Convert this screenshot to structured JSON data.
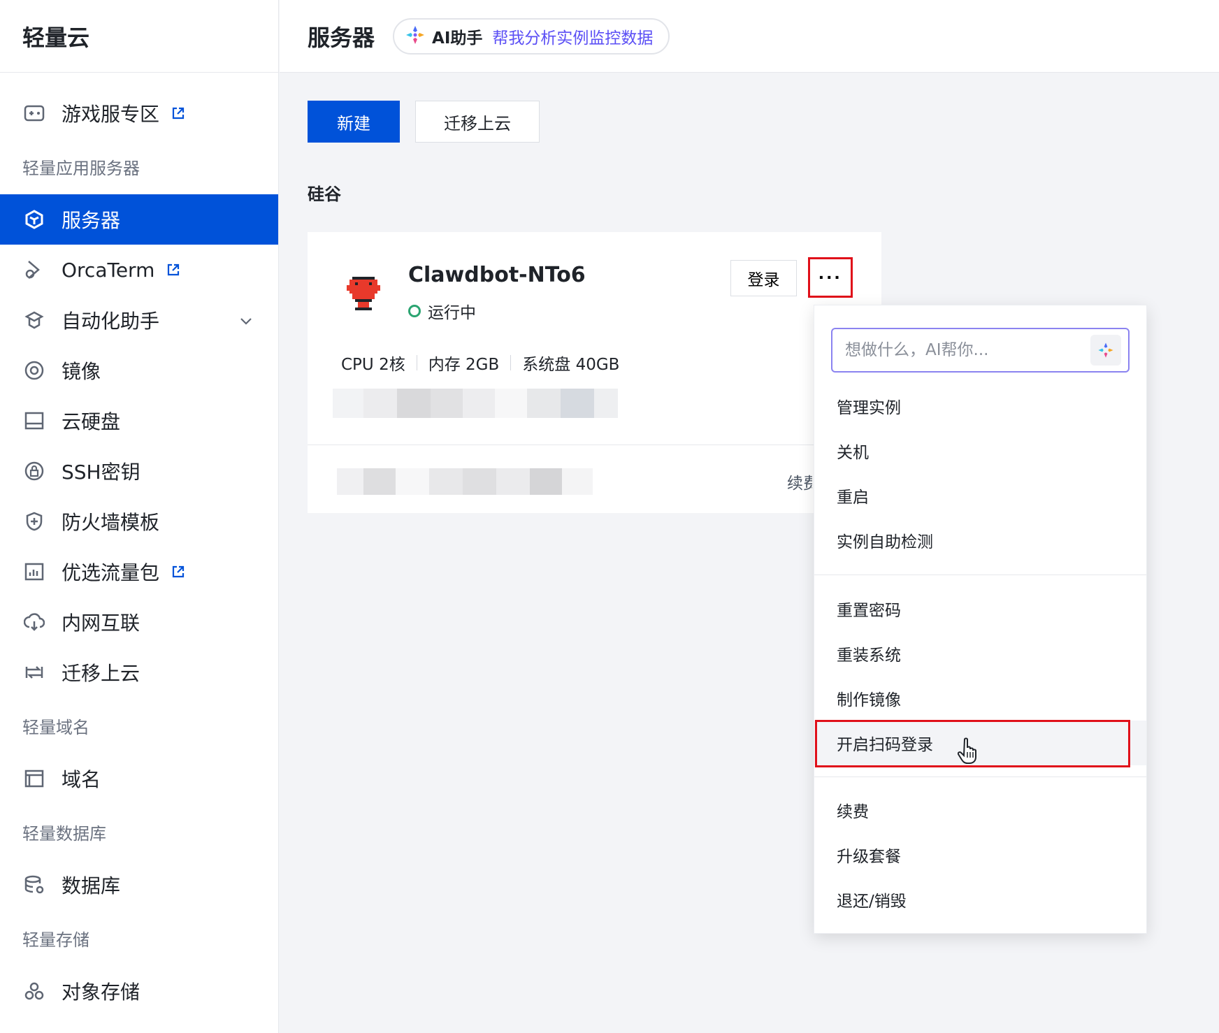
{
  "sidebar": {
    "brand": "轻量云",
    "items": [
      {
        "label": "游戏服专区",
        "icon": "gamepad-icon",
        "external": true
      },
      {
        "group": "轻量应用服务器"
      },
      {
        "label": "服务器",
        "icon": "server-cube-icon",
        "active": true
      },
      {
        "label": "OrcaTerm",
        "icon": "orcaterm-icon",
        "external": true
      },
      {
        "label": "自动化助手",
        "icon": "automation-icon",
        "expandable": true
      },
      {
        "label": "镜像",
        "icon": "image-disc-icon"
      },
      {
        "label": "云硬盘",
        "icon": "cloud-disk-icon"
      },
      {
        "label": "SSH密钥",
        "icon": "ssh-key-icon"
      },
      {
        "label": "防火墙模板",
        "icon": "firewall-shield-icon"
      },
      {
        "label": "优选流量包",
        "icon": "traffic-package-icon",
        "external": true
      },
      {
        "label": "内网互联",
        "icon": "intranet-icon"
      },
      {
        "label": "迁移上云",
        "icon": "migrate-icon"
      },
      {
        "group": "轻量域名"
      },
      {
        "label": "域名",
        "icon": "domain-window-icon"
      },
      {
        "group": "轻量数据库"
      },
      {
        "label": "数据库",
        "icon": "database-icon"
      },
      {
        "group": "轻量存储"
      },
      {
        "label": "对象存储",
        "icon": "object-storage-icon"
      }
    ]
  },
  "header": {
    "title": "服务器",
    "ai_label": "AI助手",
    "ai_suggestion": "帮我分析实例监控数据"
  },
  "toolbar": {
    "new_label": "新建",
    "migrate_label": "迁移上云"
  },
  "region": "硅谷",
  "instance": {
    "name": "Clawdbot-NTo6",
    "status": "运行中",
    "login_label": "登录",
    "more_label": "···",
    "specs": [
      "CPU 2核",
      "内存 2GB",
      "系统盘 40GB"
    ],
    "renew_partial": "续费"
  },
  "menu": {
    "search_placeholder": "想做什么，AI帮你...",
    "items": [
      "管理实例",
      "关机",
      "重启",
      "实例自助检测",
      "重置密码",
      "重装系统",
      "制作镜像",
      "开启扫码登录",
      "续费",
      "升级套餐",
      "退还/销毁"
    ],
    "highlighted": "开启扫码登录"
  },
  "colors": {
    "primary": "#0052d9",
    "status_running": "#2ba471",
    "highlight_box": "#e0101a",
    "ai_purple": "#5b4ff5"
  }
}
